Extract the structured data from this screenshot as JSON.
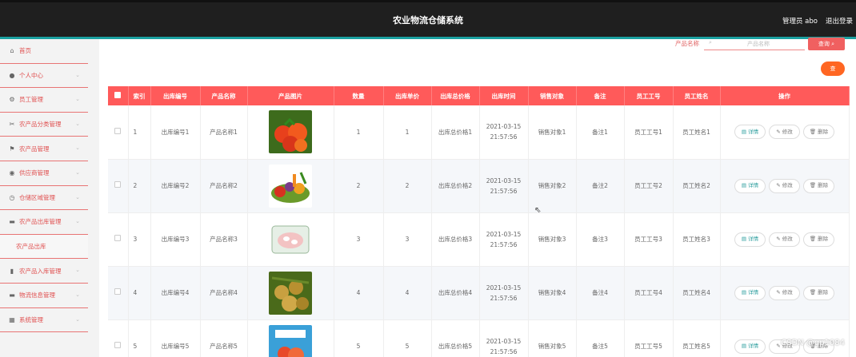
{
  "header": {
    "title": "农业物流仓储系统",
    "user": "管理员 abo",
    "logout": "退出登录"
  },
  "sidebar": {
    "items": [
      {
        "label": "首页",
        "icon": "home-icon",
        "glyph": "⌂",
        "chev": false
      },
      {
        "label": "个人中心",
        "icon": "user-icon",
        "glyph": "●",
        "chev": true
      },
      {
        "label": "员工管理",
        "icon": "settings-icon",
        "glyph": "⚙",
        "chev": true
      },
      {
        "label": "农产品分类管理",
        "icon": "tools-icon",
        "glyph": "✂",
        "chev": true
      },
      {
        "label": "农产品管理",
        "icon": "flag-icon",
        "glyph": "⚑",
        "chev": true
      },
      {
        "label": "供应商管理",
        "icon": "location-icon",
        "glyph": "◉",
        "chev": true
      },
      {
        "label": "仓储区域管理",
        "icon": "clock-icon",
        "glyph": "◷",
        "chev": true
      },
      {
        "label": "农产品出库管理",
        "icon": "monitor-icon",
        "glyph": "▬",
        "chev": true
      },
      {
        "label": "农产品入库管理",
        "icon": "chart-icon",
        "glyph": "▮",
        "chev": true
      },
      {
        "label": "物流信息管理",
        "icon": "message-icon",
        "glyph": "▬",
        "chev": true
      },
      {
        "label": "系统管理",
        "icon": "grid-icon",
        "glyph": "▦",
        "chev": true
      }
    ],
    "sub_item": "农产品出库"
  },
  "search": {
    "label": "产品名称",
    "placeholder": "产品名称",
    "button": "查询 ⌕"
  },
  "orange_button": "查",
  "table": {
    "headers": [
      "",
      "索引",
      "出库编号",
      "产品名称",
      "产品图片",
      "数量",
      "出库单价",
      "出库总价格",
      "出库时间",
      "销售对象",
      "备注",
      "员工工号",
      "员工姓名",
      "操作"
    ],
    "rows": [
      {
        "index": "1",
        "code": "出库编号1",
        "name": "产品名称1",
        "qty": "1",
        "price": "1",
        "total": "出库总价格1",
        "time": "2021-03-15 21:57:56",
        "buyer": "销售对象1",
        "note": "备注1",
        "empno": "员工工号1",
        "empname": "员工姓名1",
        "img": "tomatoes"
      },
      {
        "index": "2",
        "code": "出库编号2",
        "name": "产品名称2",
        "qty": "2",
        "price": "2",
        "total": "出库总价格2",
        "time": "2021-03-15 21:57:56",
        "buyer": "销售对象2",
        "note": "备注2",
        "empno": "员工工号2",
        "empname": "员工姓名2",
        "img": "veggies"
      },
      {
        "index": "3",
        "code": "出库编号3",
        "name": "产品名称3",
        "qty": "3",
        "price": "3",
        "total": "出库总价格3",
        "time": "2021-03-15 21:57:56",
        "buyer": "销售对象3",
        "note": "备注3",
        "empno": "员工工号3",
        "empname": "员工姓名3",
        "img": "tray"
      },
      {
        "index": "4",
        "code": "出库编号4",
        "name": "产品名称4",
        "qty": "4",
        "price": "4",
        "total": "出库总价格4",
        "time": "2021-03-15 21:57:56",
        "buyer": "销售对象4",
        "note": "备注4",
        "empno": "员工工号4",
        "empname": "员工姓名4",
        "img": "fruit"
      },
      {
        "index": "5",
        "code": "出库编号5",
        "name": "产品名称5",
        "qty": "5",
        "price": "5",
        "total": "出库总价格5",
        "time": "2021-03-15 21:57:56",
        "buyer": "销售对象5",
        "note": "备注5",
        "empno": "员工工号5",
        "empname": "员工姓名5",
        "img": "package"
      }
    ],
    "ops": {
      "detail": "详情",
      "edit": "修改",
      "delete": "删除"
    }
  },
  "watermark": "CSDN @gp1084"
}
